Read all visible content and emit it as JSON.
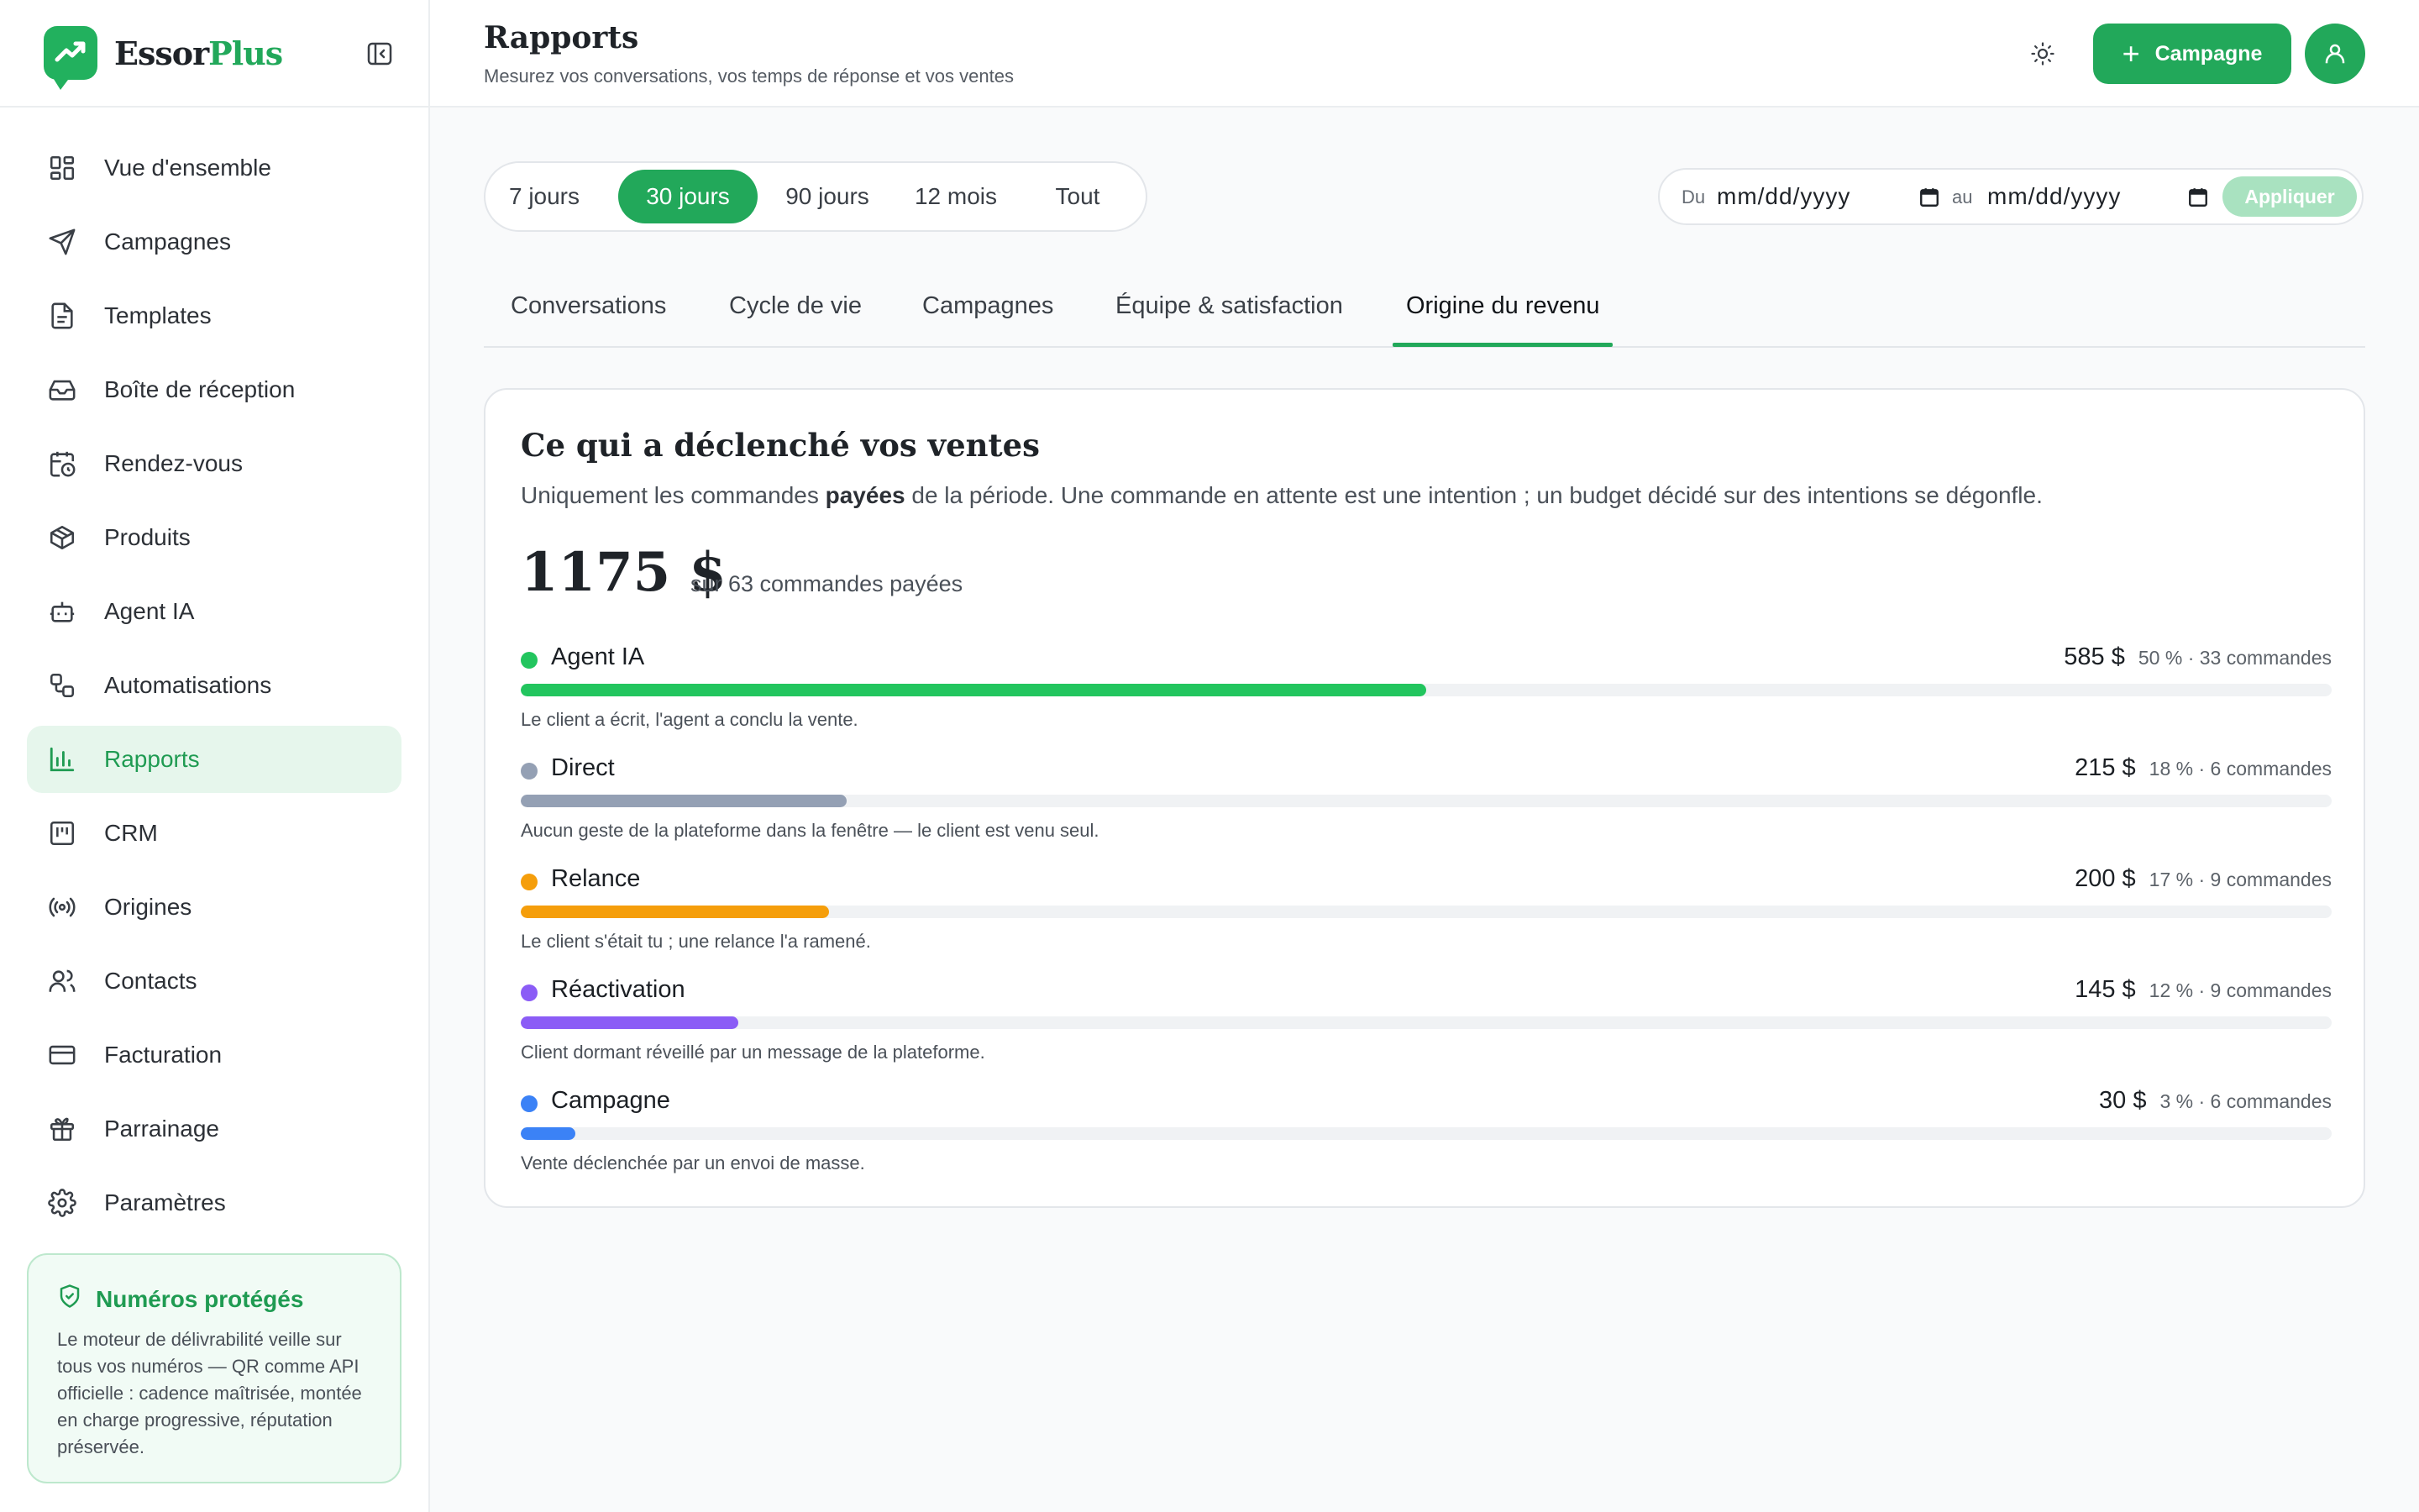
{
  "app": {
    "brand_main": "Essor",
    "brand_accent": "Plus",
    "accent_color": "#22a85a"
  },
  "sidebar": {
    "items": [
      {
        "label": "Vue d'ensemble",
        "icon": "grid-icon"
      },
      {
        "label": "Campagnes",
        "icon": "send-icon"
      },
      {
        "label": "Templates",
        "icon": "document-icon"
      },
      {
        "label": "Boîte de réception",
        "icon": "inbox-icon"
      },
      {
        "label": "Rendez-vous",
        "icon": "calendar-clock-icon"
      },
      {
        "label": "Produits",
        "icon": "package-icon"
      },
      {
        "label": "Agent IA",
        "icon": "bot-icon"
      },
      {
        "label": "Automatisations",
        "icon": "workflow-icon"
      },
      {
        "label": "Rapports",
        "icon": "bar-chart-icon",
        "active": true
      },
      {
        "label": "CRM",
        "icon": "kanban-icon"
      },
      {
        "label": "Origines",
        "icon": "radio-icon"
      },
      {
        "label": "Contacts",
        "icon": "users-icon"
      },
      {
        "label": "Facturation",
        "icon": "credit-card-icon"
      },
      {
        "label": "Parrainage",
        "icon": "gift-icon"
      },
      {
        "label": "Paramètres",
        "icon": "gear-icon"
      }
    ],
    "protect_card": {
      "title": "Numéros protégés",
      "text": "Le moteur de délivrabilité veille sur tous vos numéros — QR comme API officielle : cadence maîtrisée, montée en charge progressive, réputation préservée."
    }
  },
  "header": {
    "title": "Rapports",
    "subtitle": "Mesurez vos conversations, vos temps de réponse et vos ventes",
    "campaign_button": "Campagne",
    "campaign_plus": "+"
  },
  "filters": {
    "ranges": [
      "7 jours",
      "30 jours",
      "90 jours",
      "12 mois",
      "Tout"
    ],
    "active_range": "30 jours",
    "date_from_label": "Du",
    "date_from_value": "mm/dd/yyyy",
    "date_to_label": "au",
    "date_to_value": "mm/dd/yyyy",
    "apply_label": "Appliquer"
  },
  "tabs": {
    "items": [
      "Conversations",
      "Cycle de vie",
      "Campagnes",
      "Équipe & satisfaction",
      "Origine du revenu"
    ],
    "active": "Origine du revenu"
  },
  "revenue_card": {
    "title": "Ce qui a déclenché vos ventes",
    "desc_before": "Uniquement les commandes ",
    "desc_bold": "payées",
    "desc_after": " de la période. Une commande en attente est une intention ; un budget décidé sur des intentions se dégonfle.",
    "total": "1175 $",
    "total_sub": "sur 63 commandes payées",
    "sources": [
      {
        "name": "Agent IA",
        "amount": "585 $",
        "meta": "50 % · 33 commandes",
        "share": 0.5,
        "color": "#22c55e",
        "note": "Le client a écrit, l'agent a conclu la vente."
      },
      {
        "name": "Direct",
        "amount": "215 $",
        "meta": "18 % · 6 commandes",
        "share": 0.18,
        "color": "#94a0b4",
        "note": "Aucun geste de la plateforme dans la fenêtre — le client est venu seul."
      },
      {
        "name": "Relance",
        "amount": "200 $",
        "meta": "17 % · 9 commandes",
        "share": 0.17,
        "color": "#f59e0b",
        "note": "Le client s'était tu ; une relance l'a ramené."
      },
      {
        "name": "Réactivation",
        "amount": "145 $",
        "meta": "12 % · 9 commandes",
        "share": 0.12,
        "color": "#8b5cf6",
        "note": "Client dormant réveillé par un message de la plateforme."
      },
      {
        "name": "Campagne",
        "amount": "30 $",
        "meta": "3 % · 6 commandes",
        "share": 0.03,
        "color": "#3b82f6",
        "note": "Vente déclenchée par un envoi de masse."
      }
    ]
  }
}
